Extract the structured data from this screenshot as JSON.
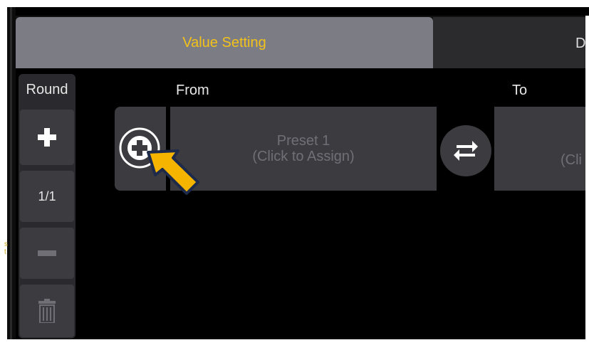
{
  "tabs": {
    "value_setting": "Value Setting",
    "second_tab_partial": "D"
  },
  "side": {
    "round_label": "Round",
    "fraction": "1/1",
    "plus_icon": "plus-icon",
    "minus_icon": "minus-icon",
    "trash_icon": "trash-icon"
  },
  "columns": {
    "from_label": "From",
    "to_label": "To"
  },
  "from_slot": {
    "line1": "Preset 1",
    "line2": "(Click to Assign)"
  },
  "to_slot": {
    "partial_text": "(Cli"
  },
  "icons": {
    "add": "add-circle-icon",
    "swap": "swap-arrows-icon",
    "pointer": "pointer-arrow-icon"
  },
  "colors": {
    "accent": "#f2c21b",
    "tab_active": "#7c7c84",
    "panel": "#3c3c40",
    "pointer_fill": "#f5b400"
  }
}
